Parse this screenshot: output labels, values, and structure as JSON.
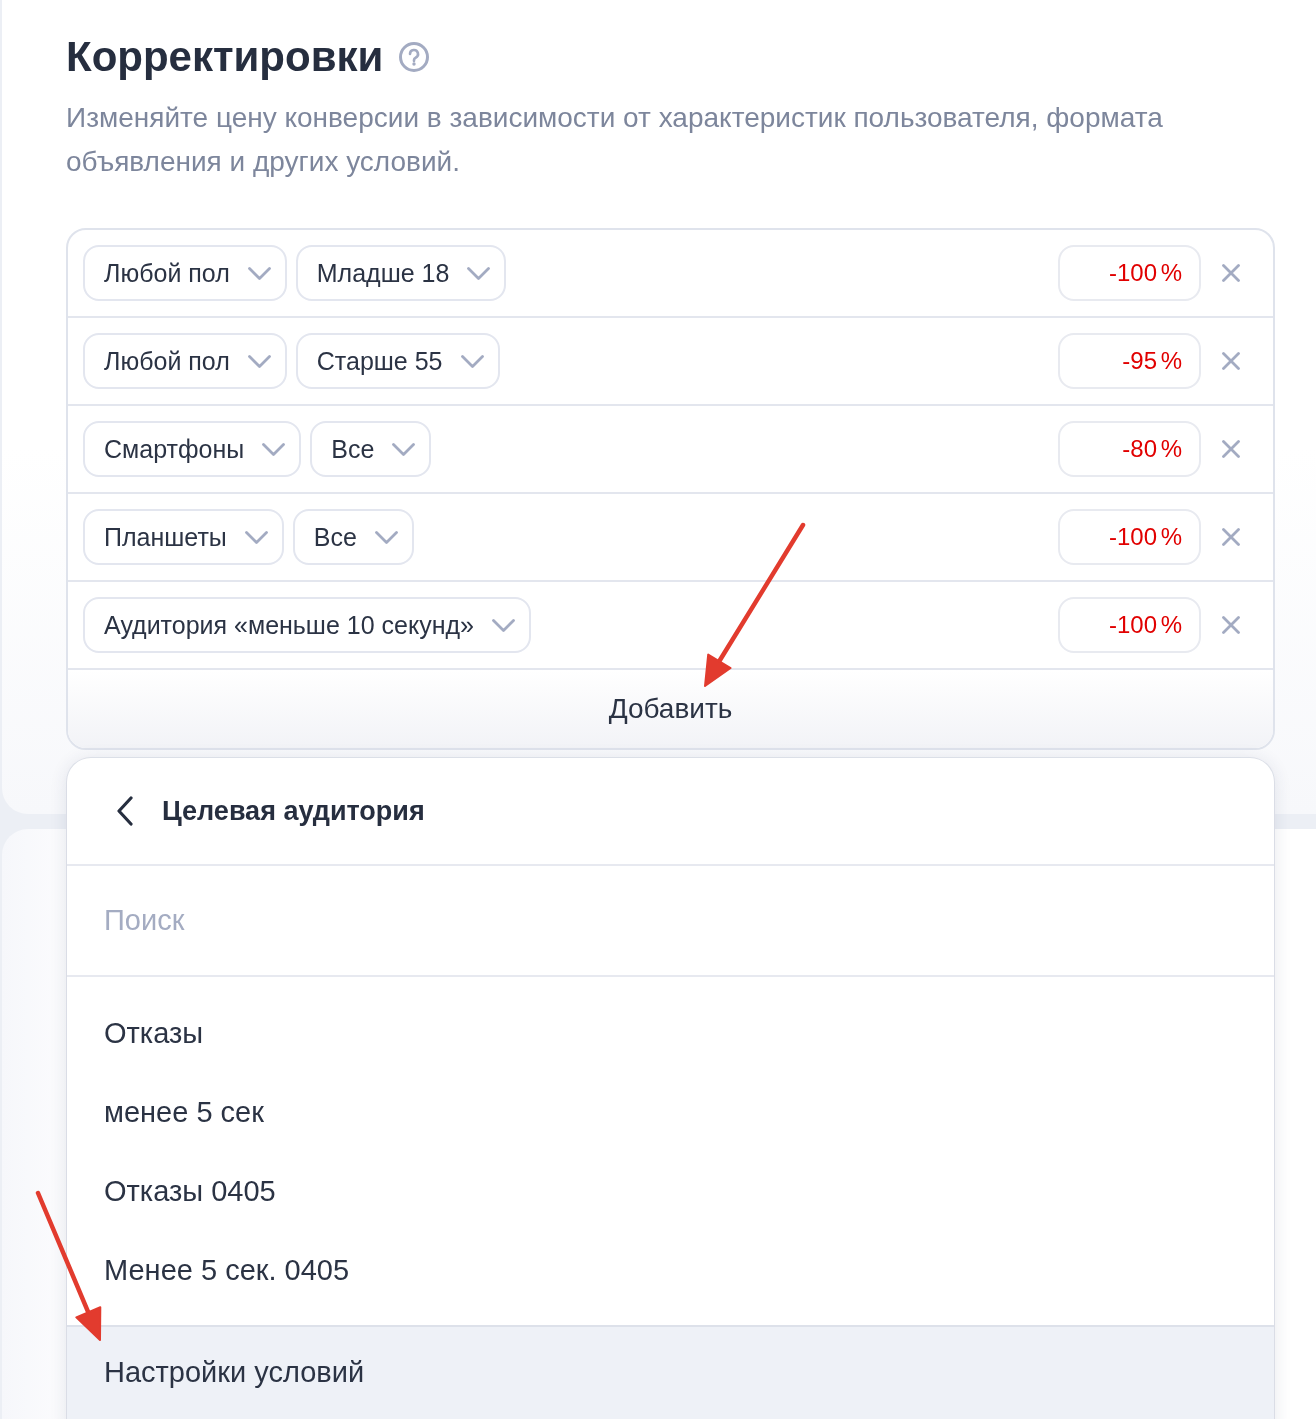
{
  "section": {
    "title": "Корректировки",
    "description": "Изменяйте цену конверсии в зависимости от характеристик пользователя, формата объявления и других условий."
  },
  "adjustments": [
    {
      "conditions": [
        "Любой пол",
        "Младше 18"
      ],
      "percent": "-100 %"
    },
    {
      "conditions": [
        "Любой пол",
        "Старше 55"
      ],
      "percent": "-95 %"
    },
    {
      "conditions": [
        "Смартфоны",
        "Все"
      ],
      "percent": "-80 %"
    },
    {
      "conditions": [
        "Планшеты",
        "Все"
      ],
      "percent": "-100 %"
    },
    {
      "conditions": [
        "Аудитория «меньше 10 секунд»"
      ],
      "percent": "-100 %"
    }
  ],
  "add_button": {
    "label": "Добавить"
  },
  "dropdown": {
    "title": "Целевая аудитория",
    "search": {
      "placeholder": "Поиск"
    },
    "items": [
      {
        "label": "Отказы"
      },
      {
        "label": "менее 5 сек"
      },
      {
        "label": "Отказы 0405"
      },
      {
        "label": "Менее 5 сек. 0405"
      }
    ],
    "footer": {
      "label": "Настройки условий"
    }
  }
}
